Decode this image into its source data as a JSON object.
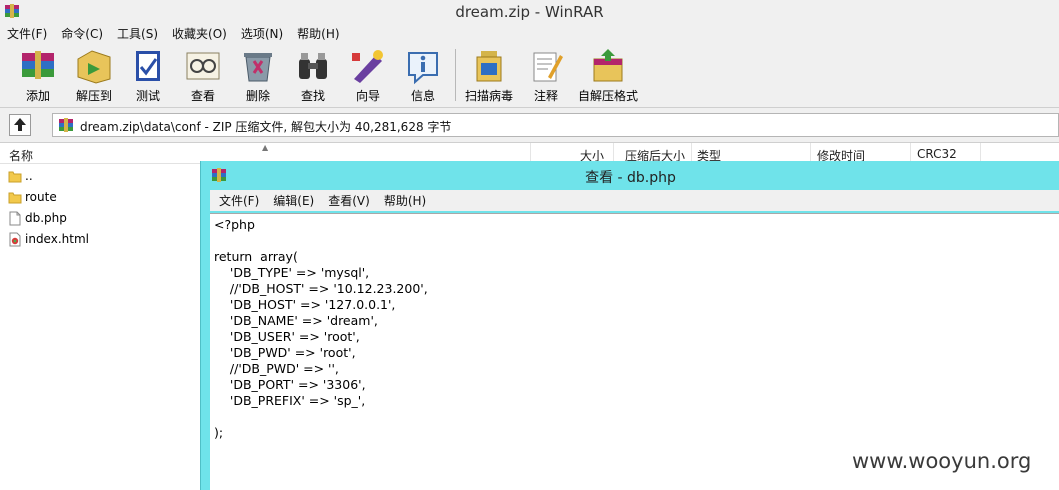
{
  "window": {
    "title": "dream.zip - WinRAR"
  },
  "menu": [
    "文件(F)",
    "命令(C)",
    "工具(S)",
    "收藏夹(O)",
    "选项(N)",
    "帮助(H)"
  ],
  "toolbar": [
    {
      "label": "添加",
      "icon": "add-archive-icon"
    },
    {
      "label": "解压到",
      "icon": "extract-to-icon"
    },
    {
      "label": "测试",
      "icon": "test-icon"
    },
    {
      "label": "查看",
      "icon": "view-icon"
    },
    {
      "label": "删除",
      "icon": "delete-icon"
    },
    {
      "label": "查找",
      "icon": "find-icon"
    },
    {
      "label": "向导",
      "icon": "wizard-icon"
    },
    {
      "label": "信息",
      "icon": "info-icon"
    },
    {
      "label": "扫描病毒",
      "icon": "virus-scan-icon"
    },
    {
      "label": "注释",
      "icon": "comment-icon"
    },
    {
      "label": "自解压格式",
      "icon": "sfx-icon"
    }
  ],
  "address": {
    "path": "dream.zip\\data\\conf - ZIP 压缩文件, 解包大小为 40,281,628 字节"
  },
  "columns": {
    "name": "名称",
    "size": "大小",
    "packed": "压缩后大小",
    "type": "类型",
    "modified": "修改时间",
    "crc": "CRC32"
  },
  "files": [
    {
      "name": "..",
      "icon": "folder-icon"
    },
    {
      "name": "route",
      "icon": "folder-icon"
    },
    {
      "name": "db.php",
      "icon": "file-icon"
    },
    {
      "name": "index.html",
      "icon": "html-file-icon"
    }
  ],
  "viewer": {
    "title": "查看 - db.php",
    "menu": [
      "文件(F)",
      "编辑(E)",
      "查看(V)",
      "帮助(H)"
    ],
    "content": "<?php\n\nreturn  array(\n    'DB_TYPE' => 'mysql',\n    //'DB_HOST' => '10.12.23.200',\n    'DB_HOST' => '127.0.0.1',\n    'DB_NAME' => 'dream',\n    'DB_USER' => 'root',\n    'DB_PWD' => 'root',\n    //'DB_PWD' => '',\n    'DB_PORT' => '3306',\n    'DB_PREFIX' => 'sp_',\n\n);"
  },
  "watermark": "www.wooyun.org",
  "colors": {
    "viewer_title_bg": "#6fe3ea",
    "chrome_bg": "#f0f0f0"
  }
}
